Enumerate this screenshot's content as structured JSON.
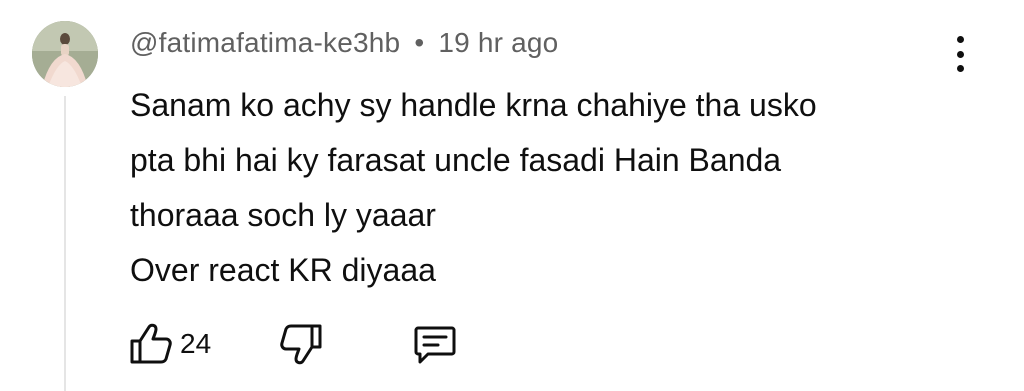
{
  "comment": {
    "author": "@fatimafatima-ke3hb",
    "separator": "•",
    "time": "19 hr ago",
    "lines": [
      "Sanam ko achy sy handle krna chahiye tha usko",
      "pta bhi hai ky farasat uncle fasadi Hain Banda",
      "thoraaa soch ly yaaar",
      "Over react KR diyaaa"
    ],
    "like_count": "24"
  },
  "icons": {
    "avatar": "user-avatar-photo",
    "menu": "more-vertical-icon",
    "like": "thumbs-up-icon",
    "dislike": "thumbs-down-icon",
    "reply": "comment-reply-icon"
  },
  "colors": {
    "text_primary": "#0f0f0f",
    "text_secondary": "#606060",
    "thread_line": "#e5e5e5"
  }
}
